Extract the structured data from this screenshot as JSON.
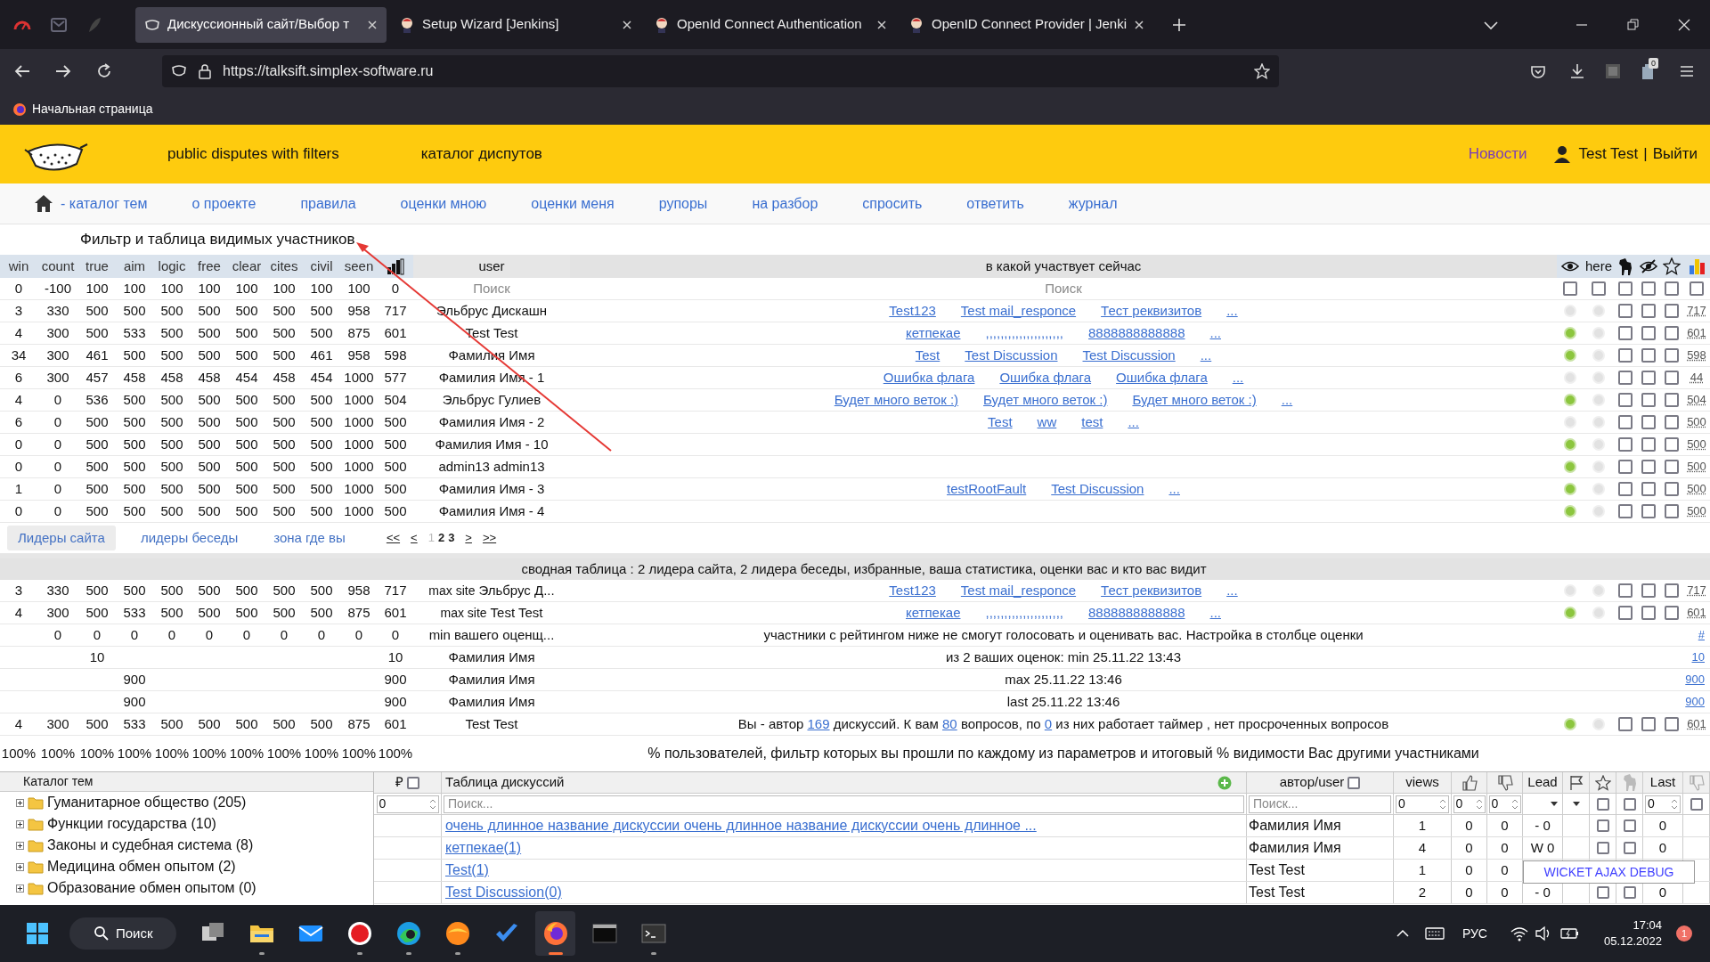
{
  "browser": {
    "tabs": [
      {
        "title": "Дискуссионный сайт/Выбор т",
        "selected": true,
        "kind": "site"
      },
      {
        "title": "Setup Wizard [Jenkins]",
        "selected": false,
        "kind": "jenkins"
      },
      {
        "title": "OpenId Connect Authentication",
        "selected": false,
        "kind": "jenkins"
      },
      {
        "title": "OpenID Connect Provider | Jenki",
        "selected": false,
        "kind": "jenkins"
      }
    ],
    "url": "https://talksift.simplex-software.ru",
    "extension_badge": "0",
    "bookmarks": [
      "Начальная страница"
    ]
  },
  "header": {
    "tagline": "public disputes with filters",
    "catalog": "каталог диспутов",
    "news": "Новости",
    "user": "Test Test",
    "separator": "|",
    "logout": "Выйти"
  },
  "menu": [
    "- каталог тем",
    "о проекте",
    "правила",
    "оценки мною",
    "оценки меня",
    "рупоры",
    "на разбор",
    "спросить",
    "ответить",
    "журнал"
  ],
  "filter": {
    "title": "Фильтр и таблица видимых участников",
    "columns": [
      "win",
      "count",
      "true",
      "aim",
      "logic",
      "free",
      "clear",
      "cites",
      "civil",
      "seen"
    ],
    "user_column": "user",
    "current_column": "в какой участвует сейчас",
    "here_label": "here",
    "search_values": [
      "0",
      "-100",
      "100",
      "100",
      "100",
      "100",
      "100",
      "100",
      "100",
      "100",
      "0"
    ],
    "user_search_placeholder": "Поиск",
    "current_search_placeholder": "Поиск",
    "search_checks": [
      false,
      false,
      false,
      false,
      false,
      false
    ],
    "rows": [
      {
        "values": [
          "3",
          "330",
          "500",
          "500",
          "500",
          "500",
          "500",
          "500",
          "500",
          "958",
          "717"
        ],
        "user": "Эльбрус Дискашн",
        "links": [
          "Test123",
          "Test mail_responce",
          "Тест реквизитов",
          "..."
        ],
        "visible": false,
        "here": false,
        "checks": [
          false,
          false,
          false
        ],
        "score": "717"
      },
      {
        "values": [
          "4",
          "300",
          "500",
          "533",
          "500",
          "500",
          "500",
          "500",
          "500",
          "875",
          "601"
        ],
        "user": "Test Test",
        "links": [
          "кетпекае",
          ",,,,,,,,,,,,,,,,,,,,,",
          "8888888888888",
          "..."
        ],
        "visible": true,
        "here": false,
        "checks": [
          false,
          false,
          false
        ],
        "score": "601"
      },
      {
        "values": [
          "34",
          "300",
          "461",
          "500",
          "500",
          "500",
          "500",
          "500",
          "461",
          "958",
          "598"
        ],
        "user": "Фамилия Имя",
        "links": [
          "Test",
          "Test Discussion",
          "Test Discussion",
          "..."
        ],
        "visible": true,
        "here": false,
        "checks": [
          false,
          false,
          false
        ],
        "score": "598"
      },
      {
        "values": [
          "6",
          "300",
          "457",
          "458",
          "458",
          "458",
          "454",
          "458",
          "454",
          "1000",
          "577"
        ],
        "user": "Фамилия Имя - 1",
        "links": [
          "Ошибка флага",
          "Ошибка флага",
          "Ошибка флага",
          "..."
        ],
        "visible": false,
        "here": false,
        "checks": [
          false,
          false,
          false
        ],
        "score": "44"
      },
      {
        "values": [
          "4",
          "0",
          "536",
          "500",
          "500",
          "500",
          "500",
          "500",
          "500",
          "1000",
          "504"
        ],
        "user": "Эльбрус Гулиев",
        "links": [
          "Будет много веток :)",
          "Будет много веток :)",
          "Будет много веток :)",
          "..."
        ],
        "visible": true,
        "here": false,
        "checks": [
          false,
          false,
          false
        ],
        "score": "504"
      },
      {
        "values": [
          "6",
          "0",
          "500",
          "500",
          "500",
          "500",
          "500",
          "500",
          "500",
          "1000",
          "500"
        ],
        "user": "Фамилия Имя - 2",
        "links": [
          "Test",
          "ww",
          "test",
          "..."
        ],
        "visible": false,
        "here": false,
        "checks": [
          false,
          false,
          false
        ],
        "score": "500"
      },
      {
        "values": [
          "0",
          "0",
          "500",
          "500",
          "500",
          "500",
          "500",
          "500",
          "500",
          "1000",
          "500"
        ],
        "user": "Фамилия Имя - 10",
        "links": [],
        "visible": true,
        "here": false,
        "checks": [
          false,
          false,
          false
        ],
        "score": "500"
      },
      {
        "values": [
          "0",
          "0",
          "500",
          "500",
          "500",
          "500",
          "500",
          "500",
          "500",
          "1000",
          "500"
        ],
        "user": "admin13 admin13",
        "links": [],
        "visible": true,
        "here": false,
        "checks": [
          false,
          false,
          false
        ],
        "score": "500"
      },
      {
        "values": [
          "1",
          "0",
          "500",
          "500",
          "500",
          "500",
          "500",
          "500",
          "500",
          "1000",
          "500"
        ],
        "user": "Фамилия Имя - 3",
        "links": [
          "testRootFault",
          "Test Discussion",
          "..."
        ],
        "visible": true,
        "here": false,
        "checks": [
          false,
          false,
          false
        ],
        "score": "500"
      },
      {
        "values": [
          "0",
          "0",
          "500",
          "500",
          "500",
          "500",
          "500",
          "500",
          "500",
          "1000",
          "500"
        ],
        "user": "Фамилия Имя - 4",
        "links": [],
        "visible": true,
        "here": false,
        "checks": [
          false,
          false,
          false
        ],
        "score": "500"
      }
    ]
  },
  "pager": {
    "tabs": [
      {
        "label": "Лидеры сайта",
        "selected": true
      },
      {
        "label": "лидеры беседы",
        "selected": false
      },
      {
        "label": "зона где вы",
        "selected": false
      }
    ],
    "first": "<<",
    "prev": "<",
    "pages": [
      {
        "label": "1",
        "current": true
      },
      {
        "label": "2",
        "current": false
      },
      {
        "label": "3",
        "current": false
      }
    ],
    "next": ">",
    "last": ">>"
  },
  "summary": {
    "title": "сводная таблица : 2 лидера сайта, 2 лидера беседы, избранные, ваша статистика, оценки вас и кто вас видит",
    "rows": [
      {
        "kind": "leader",
        "values": {
          "win": "3",
          "count": "330",
          "true": "500",
          "aim": "500",
          "logic": "500",
          "free": "500",
          "clear": "500",
          "cites": "500",
          "civil": "500",
          "seen": "958",
          "rating": "717"
        },
        "label": "max site",
        "user": "Эльбрус Д...",
        "links": [
          "Test123",
          "Test mail_responce",
          "Тест реквизитов",
          "..."
        ],
        "visible": false,
        "here": false,
        "checks": [
          false,
          false,
          false
        ],
        "score": "717"
      },
      {
        "kind": "leader",
        "values": {
          "win": "4",
          "count": "300",
          "true": "500",
          "aim": "533",
          "logic": "500",
          "free": "500",
          "clear": "500",
          "cites": "500",
          "civil": "500",
          "seen": "875",
          "rating": "601"
        },
        "label": "max site",
        "user": "Test Test",
        "links": [
          "кетпекае",
          ",,,,,,,,,,,,,,,,,,,,,",
          "8888888888888",
          "..."
        ],
        "visible": true,
        "here": false,
        "checks": [
          false,
          false,
          false
        ],
        "score": "601"
      },
      {
        "kind": "note",
        "values": {
          "count": "0",
          "true": "0",
          "aim": "0",
          "logic": "0",
          "free": "0",
          "clear": "0",
          "cites": "0",
          "civil": "0",
          "seen": "0",
          "rating": "0"
        },
        "user": "min вашего оценщ...",
        "note": "участники с рейтингом ниже не смогут голосовать и оценивать вас. Настройка в столбце оценки",
        "score": "#"
      },
      {
        "kind": "note",
        "values": {
          "true": "10",
          "rating": "10"
        },
        "user": "Фамилия Имя",
        "note": "из 2 ваших оценок: min 25.11.22 13:43",
        "score": "10"
      },
      {
        "kind": "note",
        "values": {
          "aim": "900",
          "rating": "900"
        },
        "user": "Фамилия Имя",
        "note": "max 25.11.22 13:46",
        "score": "900"
      },
      {
        "kind": "note",
        "values": {
          "aim": "900",
          "rating": "900"
        },
        "user": "Фамилия Имя",
        "note": "last 25.11.22 13:46",
        "score": "900"
      },
      {
        "kind": "self",
        "values": {
          "win": "4",
          "count": "300",
          "true": "500",
          "aim": "533",
          "logic": "500",
          "free": "500",
          "clear": "500",
          "cites": "500",
          "civil": "500",
          "seen": "875",
          "rating": "601"
        },
        "user": "Test Test",
        "parts": [
          {
            "kind": "text",
            "text": "Вы - автор "
          },
          {
            "kind": "link",
            "text": "169"
          },
          {
            "kind": "text",
            "text": " дискуссий. К вам "
          },
          {
            "kind": "link",
            "text": "80"
          },
          {
            "kind": "text",
            "text": " вопросов, по "
          },
          {
            "kind": "link",
            "text": "0"
          },
          {
            "kind": "text",
            "text": " из них работает таймер , нет просроченных вопросов"
          }
        ],
        "visible": true,
        "here": false,
        "checks": [
          false,
          false,
          false
        ],
        "score": "601"
      },
      {
        "kind": "percent",
        "values": {
          "win": "100%",
          "count": "100%",
          "true": "100%",
          "aim": "100%",
          "logic": "100%",
          "free": "100%",
          "clear": "100%",
          "cites": "100%",
          "civil": "100%",
          "seen": "100%",
          "rating": "100%"
        },
        "note": "% пользователей, фильтр которых вы прошли по каждому из параметров и итоговый % видимости Вас другими участниками"
      }
    ]
  },
  "catalog": {
    "title": "Каталог тем",
    "items": [
      {
        "label": "Гуманитарное общество (205)",
        "expanded": false
      },
      {
        "label": "Функции государства (10)",
        "expanded": false
      },
      {
        "label": "Законы и судебная система (8)",
        "expanded": false
      },
      {
        "label": "Медицина обмен опытом (2)",
        "expanded": false
      },
      {
        "label": "Образование обмен опытом (0)",
        "expanded": false
      }
    ]
  },
  "discussions": {
    "currency": "₽",
    "currency_checked": false,
    "title": "Таблица дискуссий",
    "author": "автор/user",
    "author_checked": false,
    "views": "views",
    "lead": "Lead",
    "last": "Last",
    "filter": {
      "price": "0",
      "title_placeholder": "Поиск...",
      "author_placeholder": "Поиск...",
      "views": "0",
      "likes": "0",
      "dislikes": "0",
      "star_checked": false,
      "dog_checked": false,
      "last": "0",
      "last_checked": false
    },
    "rows": [
      {
        "title": "очень длинное название дискуссии очень длинное название дискуссии очень длинное ...",
        "author": "Фамилия Имя",
        "views": "1",
        "likes": "0",
        "dislikes": "0",
        "lead": "- 0",
        "checks": [
          false,
          false
        ],
        "last": "0"
      },
      {
        "title": "кетпекае(1)",
        "author": "Фамилия Имя",
        "views": "4",
        "likes": "0",
        "dislikes": "0",
        "lead": "W 0",
        "checks": [
          false,
          false
        ],
        "last": "0"
      },
      {
        "title": "Test(1)",
        "author": "Test Test",
        "views": "1",
        "likes": "0",
        "dislikes": "0"
      },
      {
        "title": "Test Discussion(0)",
        "author": "Test Test",
        "views": "2",
        "likes": "0",
        "dislikes": "0",
        "lead": "- 0",
        "checks": [
          false,
          false
        ],
        "last": "0"
      }
    ]
  },
  "debug_button": "WICKET AJAX DEBUG",
  "taskbar": {
    "search": "Поиск",
    "apps": [
      {
        "kind": "taskview",
        "running": false,
        "active": false
      },
      {
        "kind": "explorer",
        "running": true,
        "active": false
      },
      {
        "kind": "mail",
        "running": false,
        "active": false
      },
      {
        "kind": "yandex",
        "running": true,
        "active": false
      },
      {
        "kind": "edge",
        "running": true,
        "active": false
      },
      {
        "kind": "sphere",
        "running": true,
        "active": false
      },
      {
        "kind": "todo",
        "running": false,
        "active": false
      },
      {
        "kind": "firefox",
        "running": true,
        "active": true
      },
      {
        "kind": "terminal",
        "running": false,
        "active": false
      },
      {
        "kind": "console",
        "running": true,
        "active": false
      }
    ],
    "language": "РУС",
    "time": "17:04",
    "date": "05.12.2022",
    "notifications": "1"
  }
}
